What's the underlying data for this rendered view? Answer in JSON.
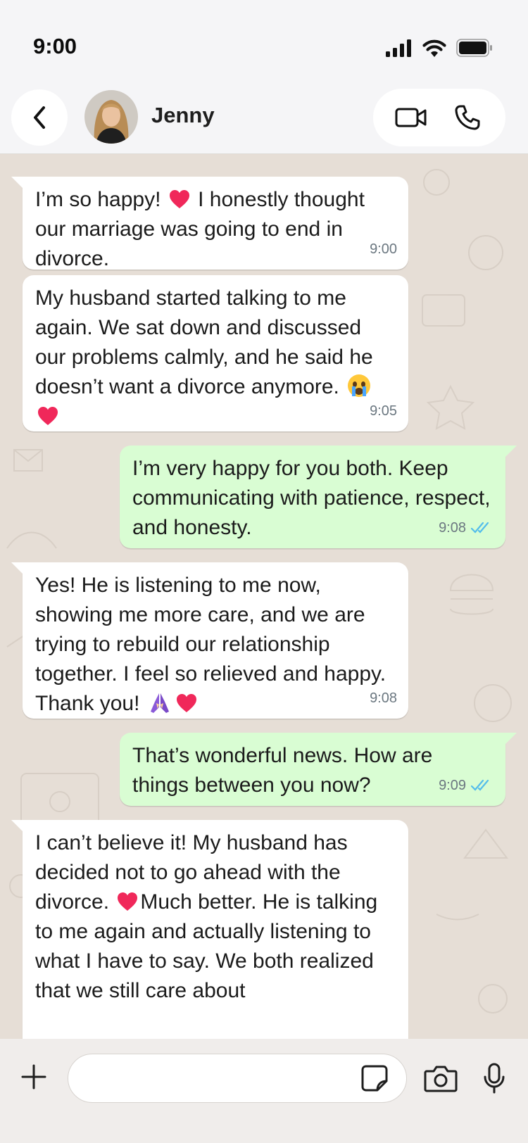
{
  "status_bar": {
    "time": "9:00",
    "icons": [
      "signal-icon",
      "wifi-icon",
      "battery-icon"
    ]
  },
  "header": {
    "back_icon": "chevron-left-icon",
    "contact_name": "Jenny",
    "video_icon": "video-camera-icon",
    "call_icon": "phone-icon"
  },
  "messages": [
    {
      "direction": "incoming",
      "text_before": "I’m so happy! ",
      "text_after": " I honestly thought our marriage was going to end in divorce.",
      "time": "9:00"
    },
    {
      "direction": "incoming",
      "text": "My husband started talking to me again. We sat down and discussed our problems calmly, and he said he doesn’t want a divorce anymore.",
      "time": "9:05"
    },
    {
      "direction": "outgoing",
      "text": "I’m very happy for you both. Keep communicating with patience, respect, and honesty.",
      "time": "9:08",
      "status": "read"
    },
    {
      "direction": "incoming",
      "text": "Yes! He is listening to me now, showing me more care, and we are trying to rebuild our relationship together. I feel so relieved and happy. Thank you!",
      "time": "9:08"
    },
    {
      "direction": "outgoing",
      "text": "That’s wonderful news. How are things between you now?",
      "time": "9:09",
      "status": "read"
    },
    {
      "direction": "incoming",
      "text_before": "I can’t believe it! My husband has decided not to go ahead with the divorce. ",
      "text_after": "Much better. He is talking to me again and actually listening to what I have to say. We both realized that we still care about"
    }
  ],
  "composer": {
    "placeholder": "",
    "plus_icon": "plus-icon",
    "sticker_icon": "sticker-icon",
    "camera_icon": "camera-icon",
    "mic_icon": "microphone-icon"
  },
  "colors": {
    "incoming_bubble": "#ffffff",
    "outgoing_bubble": "#d9fdd3",
    "chat_background": "#e6ded6",
    "read_receipt": "#53bdeb"
  }
}
